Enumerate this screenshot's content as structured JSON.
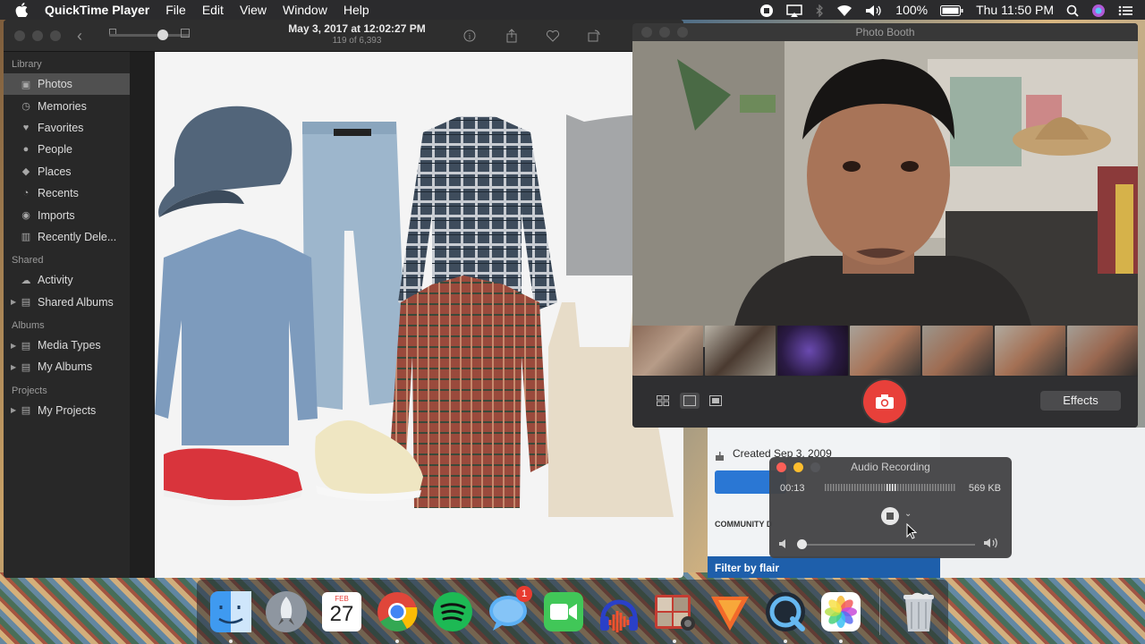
{
  "menubar": {
    "app_name": "QuickTime Player",
    "menus": [
      "File",
      "Edit",
      "View",
      "Window",
      "Help"
    ],
    "battery": "100%",
    "clock": "Thu 11:50 PM"
  },
  "photos": {
    "date": "May 3, 2017 at 12:02:27 PM",
    "count": "119 of 6,393",
    "sidebar": {
      "library_header": "Library",
      "library_items": [
        "Photos",
        "Memories",
        "Favorites",
        "People",
        "Places",
        "Recents",
        "Imports",
        "Recently Dele..."
      ],
      "shared_header": "Shared",
      "shared_items": [
        "Activity",
        "Shared Albums"
      ],
      "albums_header": "Albums",
      "albums_items": [
        "Media Types",
        "My Albums"
      ],
      "projects_header": "Projects",
      "projects_items": [
        "My Projects"
      ]
    }
  },
  "background_window": {
    "created": "Created Sep 3, 2009",
    "community": "COMMUNITY D",
    "filter": "Filter by flair"
  },
  "photo_booth": {
    "title": "Photo Booth",
    "effects_label": "Effects"
  },
  "audio_recording": {
    "title": "Audio Recording",
    "elapsed": "00:13",
    "size": "569 KB"
  },
  "dock": {
    "calendar_month": "FEB",
    "calendar_day": "27",
    "messages_badge": "1"
  },
  "colors": {
    "shutter": "#e8403a",
    "close": "#fc5f57",
    "minimize": "#fdbd2e",
    "selection": "#505050"
  }
}
